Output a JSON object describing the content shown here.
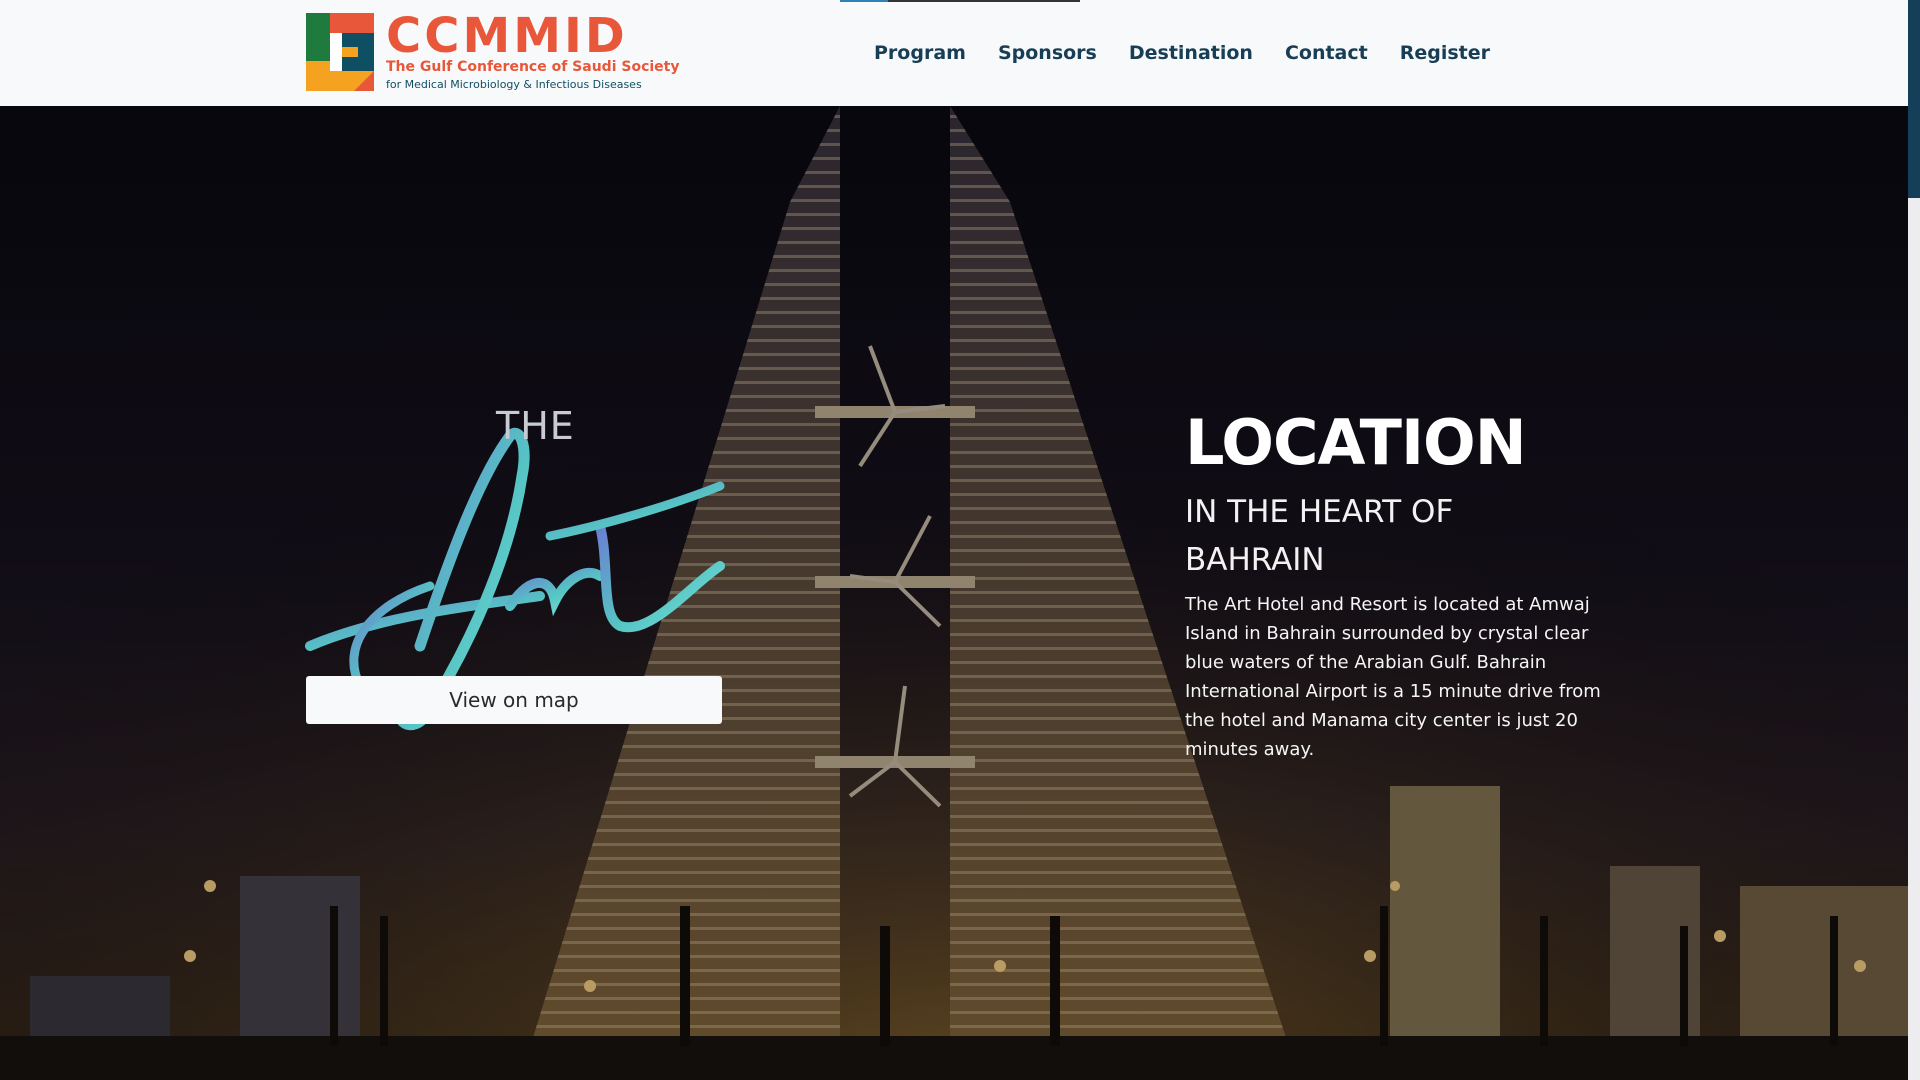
{
  "header": {
    "logo": {
      "wordmark": "CCMMID",
      "subtitle_line1": "The Gulf Conference of Saudi Society",
      "subtitle_line2": "for Medical Microbiology & Infectious Diseases"
    },
    "nav": [
      "Program",
      "Sponsors",
      "Destination",
      "Contact",
      "Register"
    ]
  },
  "hero": {
    "venue_logo": {
      "the": "THE",
      "script": "Art"
    },
    "map_button": "View on map",
    "title": "LOCATION",
    "subtitle": "IN THE HEART OF BAHRAIN",
    "description": "The Art Hotel and Resort is located at Amwaj Island in Bahrain surrounded by crystal clear blue waters of the Arabian Gulf. Bahrain International Airport is a 15 minute drive from the hotel and Manama city center is just 20 minutes away."
  },
  "colors": {
    "brand_orange": "#e8573a",
    "brand_teal": "#0f4f63",
    "nav_text": "#173e55",
    "active_indicator": "#2c82b8"
  },
  "icons": [
    "ccmmid-logo-mark",
    "art-script-logo",
    "bahrain-world-trade-center-photo"
  ]
}
